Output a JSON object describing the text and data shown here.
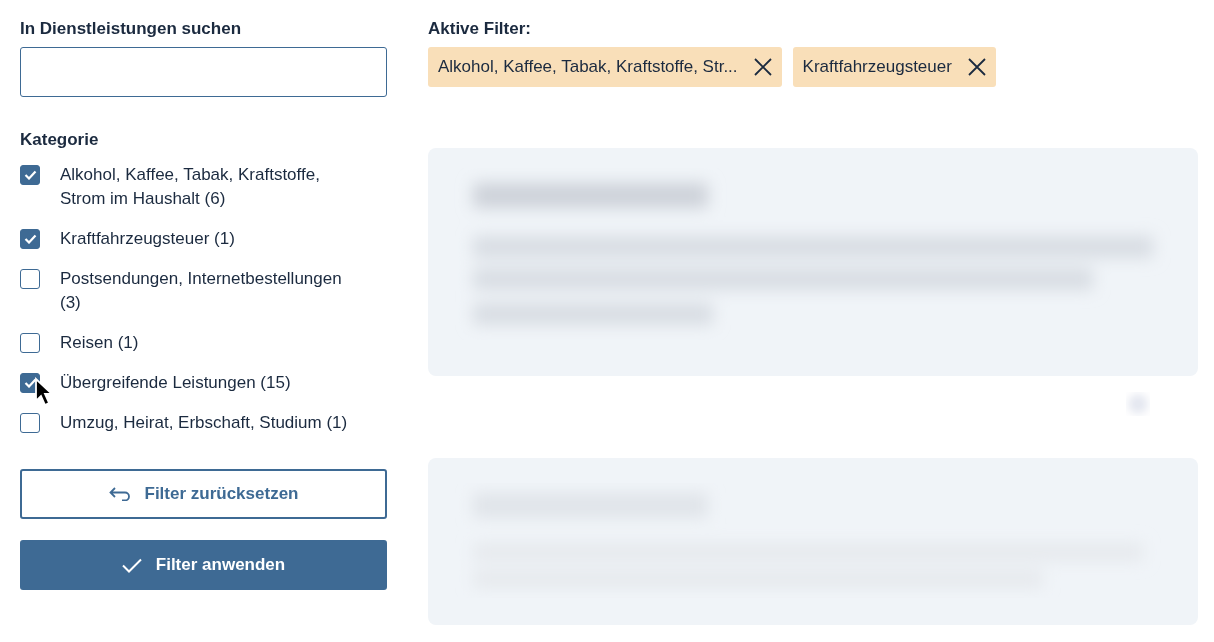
{
  "search": {
    "label": "In Dienstleistungen suchen"
  },
  "category": {
    "title": "Kategorie",
    "items": [
      {
        "label": "Alkohol, Kaffee, Tabak, Kraftstoffe, Strom im Haushalt (6)",
        "checked": true
      },
      {
        "label": "Kraftfahrzeugsteuer (1)",
        "checked": true
      },
      {
        "label": "Postsendungen, Internetbestellungen (3)",
        "checked": false
      },
      {
        "label": "Reisen (1)",
        "checked": false
      },
      {
        "label": "Übergreifende Leistungen (15)",
        "checked": true
      },
      {
        "label": "Umzug, Heirat, Erbschaft, Studium (1)",
        "checked": false
      }
    ]
  },
  "buttons": [
    {
      "label": "Filter zurücksetzen",
      "kind": "reset"
    },
    {
      "label": "Filter anwenden",
      "kind": "apply"
    }
  ],
  "active_filters": {
    "title": "Aktive Filter:",
    "chips": [
      {
        "label": "Alkohol, Kaffee, Tabak, Kraftstoffe, Str..."
      },
      {
        "label": "Kraftfahrzeugsteuer"
      }
    ]
  },
  "results": [
    {
      "kind": "blurred"
    },
    {
      "kind": "blurred"
    }
  ]
}
